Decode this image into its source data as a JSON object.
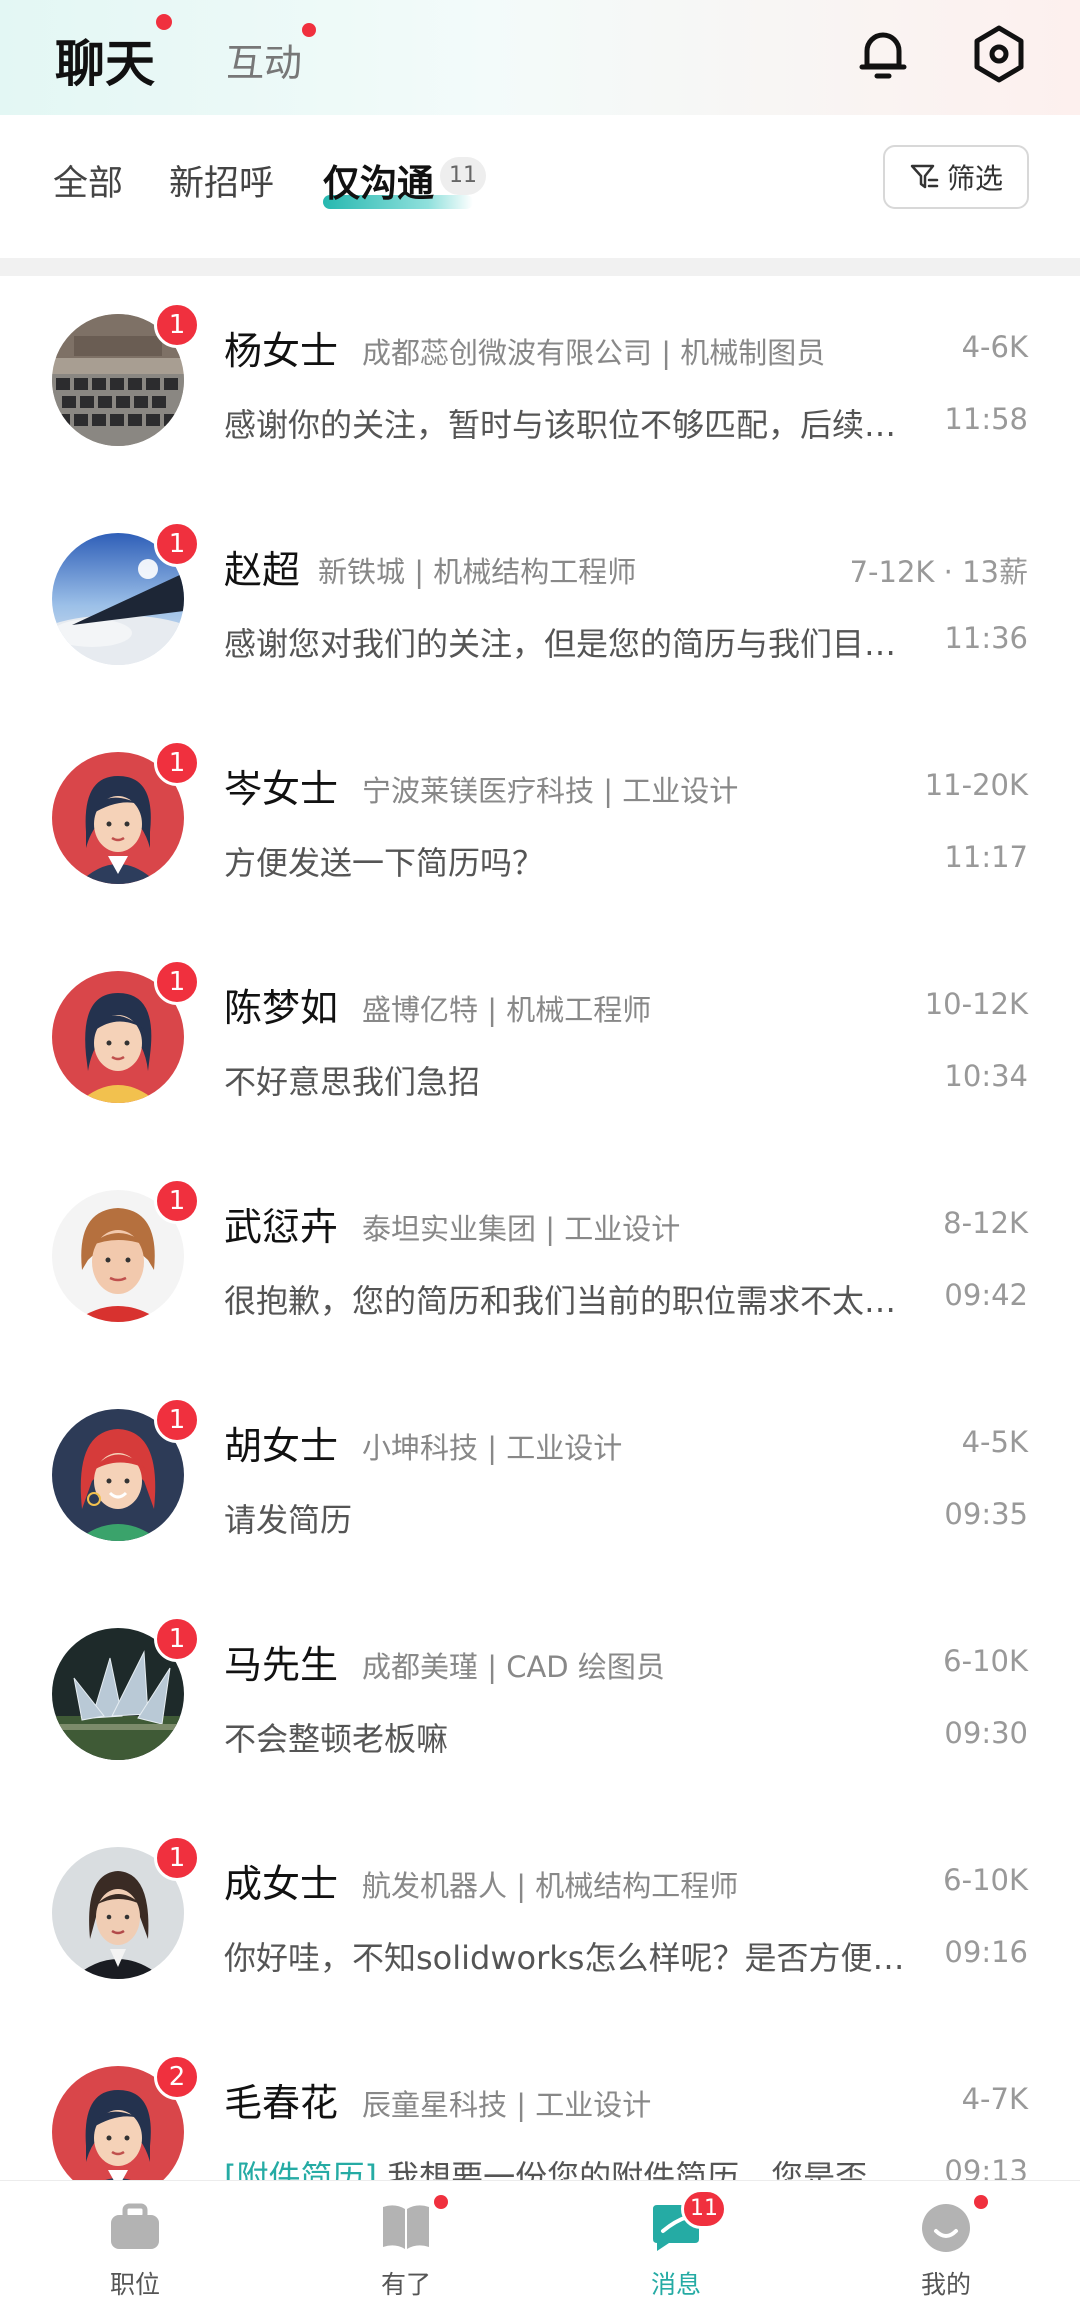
{
  "header": {
    "tab_chat": "聊天",
    "tab_interact": "互动"
  },
  "filters": {
    "all": "全部",
    "new_greeting": "新招呼",
    "only_chat": "仅沟通",
    "only_chat_count": "11",
    "filter_button": "筛选"
  },
  "chats": [
    {
      "name": "杨女士",
      "company": "成都蕊创微波有限公司 | 机械制图员",
      "salary": "4-6K",
      "message": "感谢你的关注，暂时与该职位不够匹配，后续如有合适的机会再联系您",
      "time": "11:58",
      "unread": "1",
      "avatar": "keyboard-photo"
    },
    {
      "name": "赵超",
      "company": "新铁城 | 机械结构工程师",
      "salary": "7-12K · 13薪",
      "message": "感谢您对我们的关注，但是您的简历与我们目前的岗位要求不太匹配",
      "time": "11:36",
      "unread": "1",
      "avatar": "airplane-window-photo"
    },
    {
      "name": "岑女士",
      "company": "宁波莱镁医疗科技 | 工业设计",
      "salary": "11-20K",
      "message": "方便发送一下简历吗？",
      "time": "11:17",
      "unread": "1",
      "avatar": "female-cartoon"
    },
    {
      "name": "陈梦如",
      "company": "盛博亿特 | 机械工程师",
      "salary": "10-12K",
      "message": "不好意思我们急招",
      "time": "10:34",
      "unread": "1",
      "avatar": "female-cartoon-yellow"
    },
    {
      "name": "武愆卉",
      "company": "泰坦实业集团 | 工业设计",
      "salary": "8-12K",
      "message": "很抱歉，您的简历和我们当前的职位需求不太匹配，祝您早日找到合适的工作",
      "time": "09:42",
      "unread": "1",
      "avatar": "woman-photo"
    },
    {
      "name": "胡女士",
      "company": "小坤科技 | 工业设计",
      "salary": "4-5K",
      "message": "请发简历",
      "time": "09:35",
      "unread": "1",
      "avatar": "female-cartoon-redhair"
    },
    {
      "name": "马先生",
      "company": "成都美瑾 | CAD 绘图员",
      "salary": "6-10K",
      "message": "不会整顿老板嘛",
      "time": "09:30",
      "unread": "1",
      "avatar": "sculpture-photo"
    },
    {
      "name": "成女士",
      "company": "航发机器人 | 机械结构工程师",
      "salary": "6-10K",
      "message": "你好哇，不知solidworks怎么样呢？是否方便发一份简历过来",
      "time": "09:16",
      "unread": "1",
      "avatar": "businesswoman-photo"
    },
    {
      "name": "毛春花",
      "company": "辰童星科技 | 工业设计",
      "salary": "4-7K",
      "message_tag": "[附件简历]",
      "message": " 我想要一份您的附件简历，您是否同意",
      "time": "09:13",
      "unread": "2",
      "avatar": "female-cartoon"
    }
  ],
  "bottom_nav": {
    "jobs": "职位",
    "youle": "有了",
    "messages": "消息",
    "messages_badge": "11",
    "mine": "我的"
  },
  "colors": {
    "accent": "#25aba4",
    "badge_red": "#f0303e"
  }
}
